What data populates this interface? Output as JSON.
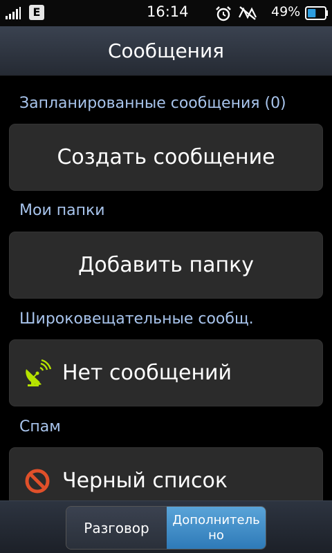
{
  "status": {
    "network_badge": "E",
    "time": "16:14",
    "battery_percent": "49%",
    "battery_level": 0.49,
    "icons": [
      "signal-icon",
      "alarm-icon",
      "silent-mode-icon",
      "battery-icon"
    ]
  },
  "header": {
    "title": "Сообщения"
  },
  "sections": [
    {
      "header": "Запланированные сообщения (0)",
      "item": "Создать сообщение",
      "icon": ""
    },
    {
      "header": "Мои папки",
      "item": "Добавить папку",
      "icon": ""
    },
    {
      "header": "Широковещательные сообщ.",
      "item": "Нет сообщений",
      "icon": "broadcast-antenna-icon"
    },
    {
      "header": "Спам",
      "item": "Черный список",
      "icon": "block-icon"
    }
  ],
  "tabs": {
    "left": "Разговор",
    "right": "Дополнитель но",
    "active": "right"
  },
  "colors": {
    "section_header": "#a8c4ec",
    "active_tab": "#3d8cc8",
    "broadcast_icon": "#b6e300",
    "block_icon": "#e0502a"
  }
}
